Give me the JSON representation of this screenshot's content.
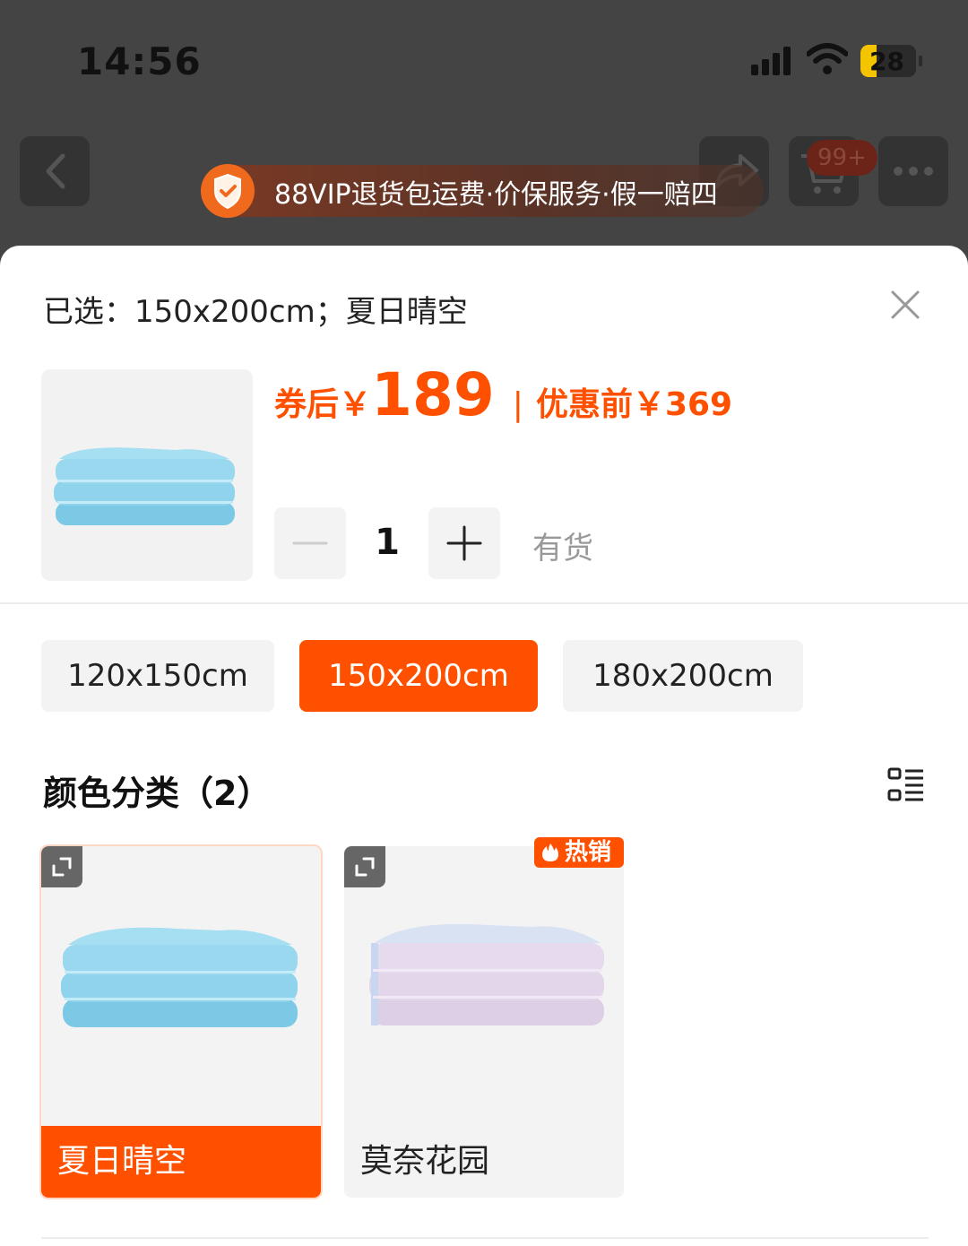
{
  "status_bar": {
    "time": "14:56",
    "battery": "28"
  },
  "nav": {
    "cart_badge": "99+",
    "vip_banner": "88VIP退货包运费·价保服务·假一赔四"
  },
  "sheet": {
    "selected_text": "已选：150x200cm；夏日晴空",
    "price_prefix": "券后￥",
    "price_value": "189",
    "price_separator": "|",
    "price_before": "优惠前￥369",
    "quantity": "1",
    "stock_status": "有货",
    "sizes": [
      {
        "label": "120x150cm",
        "selected": false
      },
      {
        "label": "150x200cm",
        "selected": true
      },
      {
        "label": "180x200cm",
        "selected": false
      }
    ],
    "color_section_title": "颜色分类（2）",
    "colors": [
      {
        "label": "夏日晴空",
        "selected": true,
        "hot": false
      },
      {
        "label": "莫奈花园",
        "selected": false,
        "hot": true
      }
    ],
    "hot_badge": "热销"
  },
  "theme": {
    "accent": "#ff5000",
    "blanket_blue": "#8fd3ec",
    "blanket_lilac": "#e3d3ea"
  },
  "icons": [
    "back-icon",
    "share-icon",
    "cart-icon",
    "more-icon",
    "shield-check-icon",
    "close-icon",
    "minus-icon",
    "plus-icon",
    "list-view-icon",
    "expand-icon",
    "fire-icon"
  ]
}
